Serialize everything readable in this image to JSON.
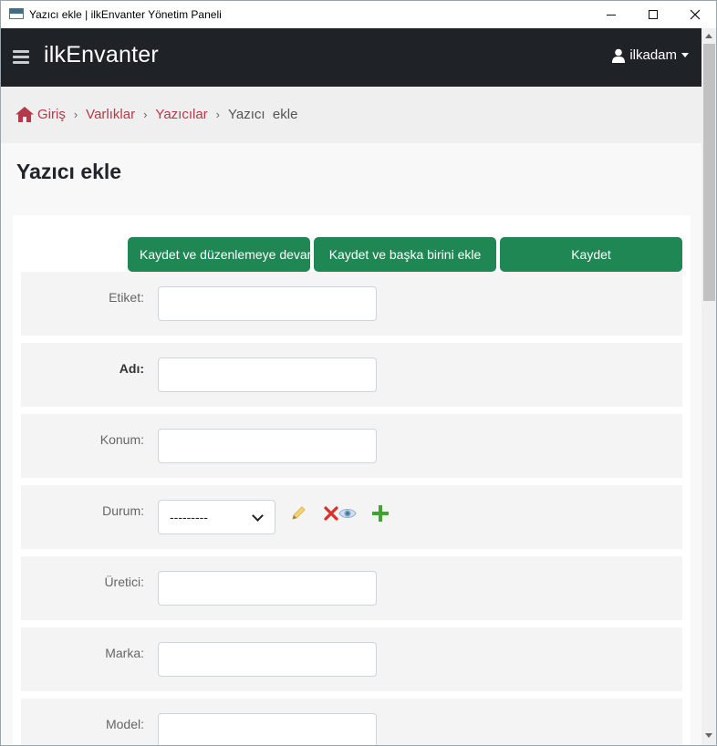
{
  "window": {
    "title": "Yazıcı ekle | ilkEnvanter Yönetim Paneli",
    "controls": [
      "minimize",
      "maximize",
      "close"
    ]
  },
  "navbar": {
    "brand": "ilkEnvanter",
    "user": "ilkadam",
    "menu_icon": "hamburger-icon"
  },
  "breadcrumb": {
    "items": [
      {
        "label": "Giriş",
        "icon": "home-icon"
      },
      {
        "label": "Varlıklar"
      },
      {
        "label": "Yazıcılar"
      }
    ],
    "current": "Yazıcı  ekle",
    "separator": "›"
  },
  "page": {
    "title": "Yazıcı ekle"
  },
  "buttons": {
    "save_continue": "Kaydet ve düzenlemeye devam et",
    "save_add_another": "Kaydet ve başka birini ekle",
    "save": "Kaydet"
  },
  "form": {
    "fields": [
      {
        "label": "Etiket:",
        "value": "",
        "required": false
      },
      {
        "label": "Adı:",
        "value": "",
        "required": true
      },
      {
        "label": "Konum:",
        "value": "",
        "required": false
      },
      {
        "label": "Durum:",
        "value": "---------",
        "type": "select"
      },
      {
        "label": "Üretici:",
        "value": "",
        "required": false
      },
      {
        "label": "Marka:",
        "value": "",
        "required": false
      },
      {
        "label": "Model:",
        "value": "",
        "required": false
      }
    ],
    "related_actions": [
      "pencil-icon",
      "delete-x-icon",
      "eye-icon",
      "plus-icon"
    ]
  },
  "colors": {
    "navbar": "#1f2327",
    "accent_green": "#1e8754",
    "breadcrumb_link": "#b5384b"
  }
}
